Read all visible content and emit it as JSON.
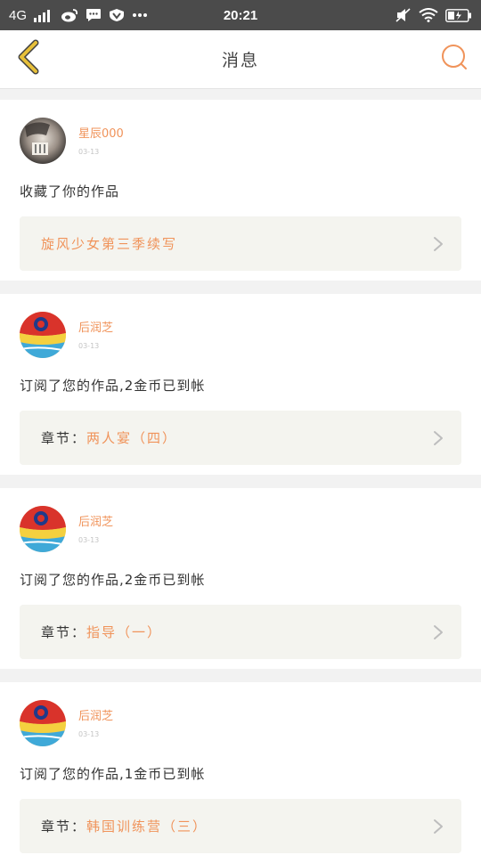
{
  "status_bar": {
    "network": "4G",
    "time": "20:21",
    "icons": [
      "signal-icon",
      "weibo-icon",
      "chat-icon",
      "vpn-icon",
      "more-dots-icon",
      "mute-icon",
      "wifi-icon",
      "battery-icon"
    ]
  },
  "header": {
    "title": "消息",
    "back_icon": "chevron-left-icon",
    "search_icon": "search-icon"
  },
  "colors": {
    "accent": "#f0935a",
    "back_arrow": "#e7c03a",
    "status_bar_bg": "#4b4b4b"
  },
  "messages": [
    {
      "user": "星辰000",
      "date": "03-13",
      "text": "收藏了你的作品",
      "link_prefix": "",
      "link_title": "旋风少女第三季续写"
    },
    {
      "user": "后润芝",
      "date": "03-13",
      "text": "订阅了您的作品,2金币已到帐",
      "link_prefix": "章节：",
      "link_title": "两人宴（四）"
    },
    {
      "user": "后润芝",
      "date": "03-13",
      "text": "订阅了您的作品,2金币已到帐",
      "link_prefix": "章节：",
      "link_title": "指导（一）"
    },
    {
      "user": "后润芝",
      "date": "03-13",
      "text": "订阅了您的作品,1金币已到帐",
      "link_prefix": "章节：",
      "link_title": "韩国训练营（三）"
    }
  ]
}
